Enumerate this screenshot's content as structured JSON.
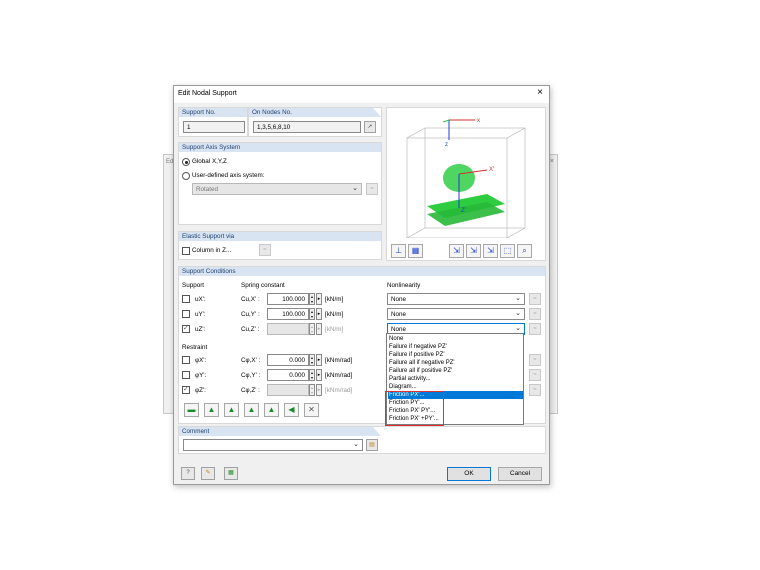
{
  "background_window": {
    "title_fragment": "Edi",
    "close": "×"
  },
  "dialog": {
    "title": "Edit Nodal Support",
    "close": "×"
  },
  "support_no": {
    "header": "Support No.",
    "value": "1"
  },
  "on_nodes": {
    "header": "On Nodes No.",
    "value": "1,3,5,6,8,10",
    "pick_icon": "pick-cursor-icon"
  },
  "axis_system": {
    "header": "Support Axis System",
    "global_label": "Global X,Y,Z",
    "user_label": "User-defined axis system:",
    "user_value": "Rotated"
  },
  "elastic": {
    "header": "Elastic Support via",
    "column_label": "Column in Z..."
  },
  "preview": {
    "axis_x": "x",
    "axis_z": "z",
    "axis_xp": "X'",
    "axis_zp": "Z'",
    "axis_y": "Y"
  },
  "conditions": {
    "header": "Support Conditions",
    "col_support": "Support",
    "col_spring": "Spring constant",
    "col_nonlin": "Nonlinearity",
    "rows": [
      {
        "label": "uX':",
        "sym": "Cu,X' :",
        "value": "100.000",
        "unit": "[kN/m]",
        "checked": false,
        "nonlin": "None"
      },
      {
        "label": "uY':",
        "sym": "Cu,Y' :",
        "value": "100.000",
        "unit": "[kN/m]",
        "checked": false,
        "nonlin": "None"
      },
      {
        "label": "uZ':",
        "sym": "Cu,Z' :",
        "value": "",
        "unit": "[kN/m]",
        "checked": true,
        "nonlin": "None"
      }
    ],
    "restraint_label": "Restraint",
    "rrows": [
      {
        "label": "φX':",
        "sym": "Cφ,X' :",
        "value": "0.000",
        "unit": "[kNm/rad]",
        "checked": false
      },
      {
        "label": "φY':",
        "sym": "Cφ,Y' :",
        "value": "0.000",
        "unit": "[kNm/rad]",
        "checked": false
      },
      {
        "label": "φZ':",
        "sym": "Cφ,Z' :",
        "value": "",
        "unit": "[kNm/rad]",
        "checked": true
      }
    ]
  },
  "dropdown_items": [
    "None",
    "Failure if negative PZ'",
    "Failure if positive PZ'",
    "Failure all if negative PZ'",
    "Failure all if positive PZ'",
    "Partial activity...",
    "Diagram...",
    "Friction PX'...",
    "Friction PY'...",
    "Friction PX' PY'...",
    "Friction PX' +PY'..."
  ],
  "dropdown_selected": "Friction PX'...",
  "comment": {
    "header": "Comment",
    "value": ""
  },
  "buttons": {
    "ok": "OK",
    "cancel": "Cancel"
  },
  "colors": {
    "header_bg": "#d9e4f2",
    "header_text": "#1d3f72",
    "selection": "#0078d7",
    "highlight_box": "#e03030",
    "support_green": "#2ecc40"
  }
}
